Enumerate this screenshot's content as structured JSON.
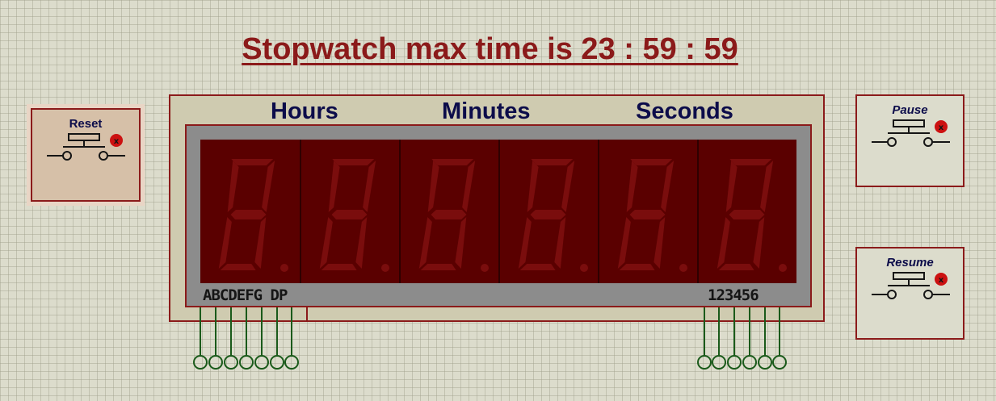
{
  "title": "Stopwatch max time is 23 : 59 : 59",
  "display": {
    "headers": [
      "Hours",
      "Minutes",
      "Seconds"
    ],
    "segment_pins_label": "ABCDEFG  DP",
    "digit_pins_label": "123456"
  },
  "buttons": {
    "reset": "Reset",
    "pause": "Pause",
    "resume": "Resume"
  },
  "colors": {
    "title": "#8b1a1a",
    "header": "#0c0c4a",
    "segment_off": "#7a0d0d",
    "wire": "#1a5a1a"
  }
}
